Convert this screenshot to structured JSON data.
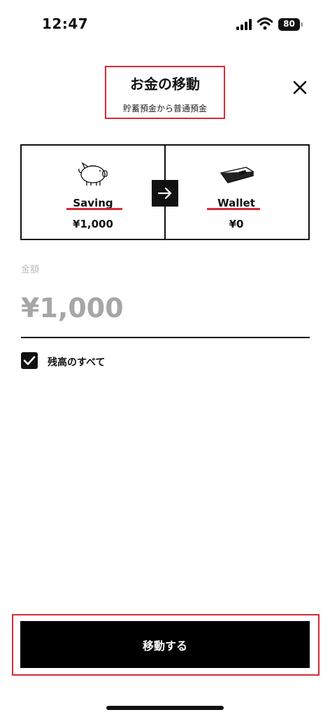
{
  "status_bar": {
    "time": "12:47",
    "battery": "80"
  },
  "header": {
    "title": "お金の移動",
    "subtitle": "貯蓄預金から普通預金"
  },
  "transfer": {
    "from": {
      "name": "Saving",
      "amount": "¥1,000",
      "icon": "piggy-bank-icon"
    },
    "to": {
      "name": "Wallet",
      "amount": "¥0",
      "icon": "wallet-icon"
    },
    "arrow_icon": "arrow-right-icon"
  },
  "amount": {
    "label": "金額",
    "value": "¥1,000"
  },
  "all_balance": {
    "label": "残高のすべて",
    "checked": true
  },
  "submit": {
    "label": "移動する"
  },
  "colors": {
    "highlight": "#d62b36",
    "primary": "#000000",
    "muted": "#a6a6a6"
  }
}
